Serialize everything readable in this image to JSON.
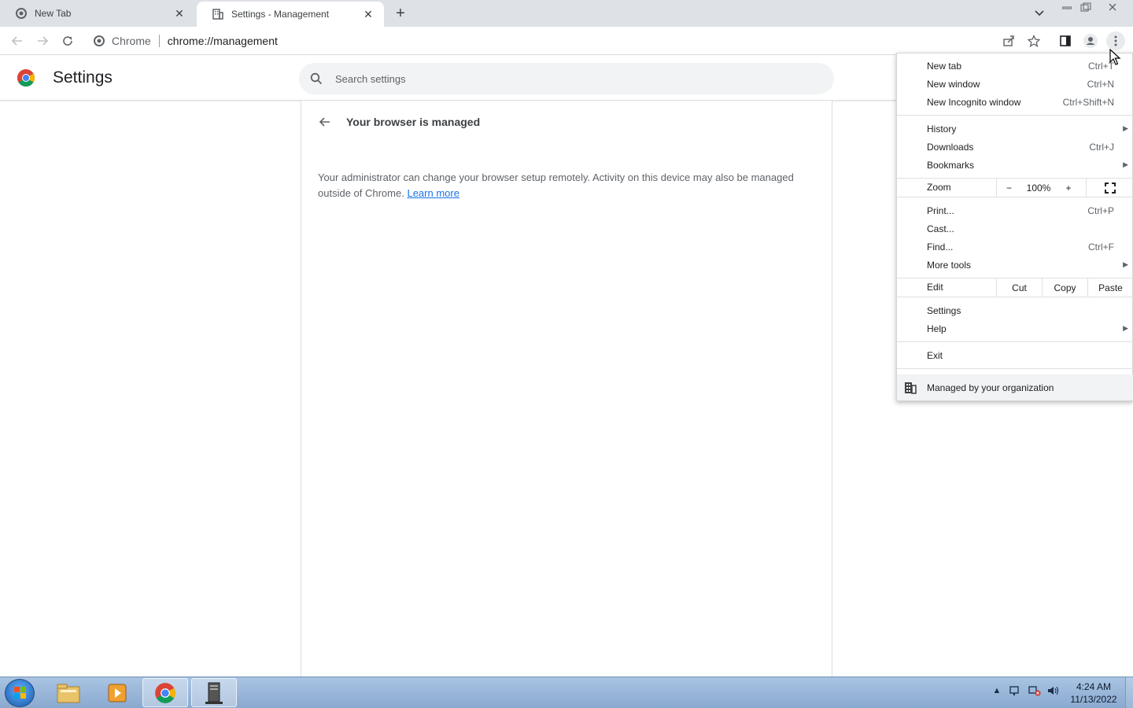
{
  "browser": {
    "tabs": [
      {
        "title": "New Tab",
        "active": false
      },
      {
        "title": "Settings - Management",
        "active": true
      }
    ],
    "omnibox": {
      "chip": "Chrome",
      "url": "chrome://management"
    }
  },
  "settings": {
    "title": "Settings",
    "search_placeholder": "Search settings",
    "section_title": "Your browser is managed",
    "body_text": "Your administrator can change your browser setup remotely. Activity on this device may also be managed outside of Chrome.",
    "learn_more": "Learn more"
  },
  "menu": {
    "items_group1": [
      {
        "label": "New tab",
        "shortcut": "Ctrl+T"
      },
      {
        "label": "New window",
        "shortcut": "Ctrl+N"
      },
      {
        "label": "New Incognito window",
        "shortcut": "Ctrl+Shift+N"
      }
    ],
    "items_group2": [
      {
        "label": "History",
        "shortcut": ""
      },
      {
        "label": "Downloads",
        "shortcut": "Ctrl+J"
      },
      {
        "label": "Bookmarks",
        "shortcut": ""
      }
    ],
    "zoom": {
      "label": "Zoom",
      "minus": "−",
      "value": "100%",
      "plus": "+"
    },
    "items_group3": [
      {
        "label": "Print...",
        "shortcut": "Ctrl+P"
      },
      {
        "label": "Cast...",
        "shortcut": ""
      },
      {
        "label": "Find...",
        "shortcut": "Ctrl+F"
      },
      {
        "label": "More tools",
        "shortcut": ""
      }
    ],
    "edit": {
      "label": "Edit",
      "cut": "Cut",
      "copy": "Copy",
      "paste": "Paste"
    },
    "items_group4": [
      {
        "label": "Settings"
      },
      {
        "label": "Help"
      }
    ],
    "exit": "Exit",
    "managed": "Managed by your organization"
  },
  "taskbar": {
    "time": "4:24 AM",
    "date": "11/13/2022"
  }
}
